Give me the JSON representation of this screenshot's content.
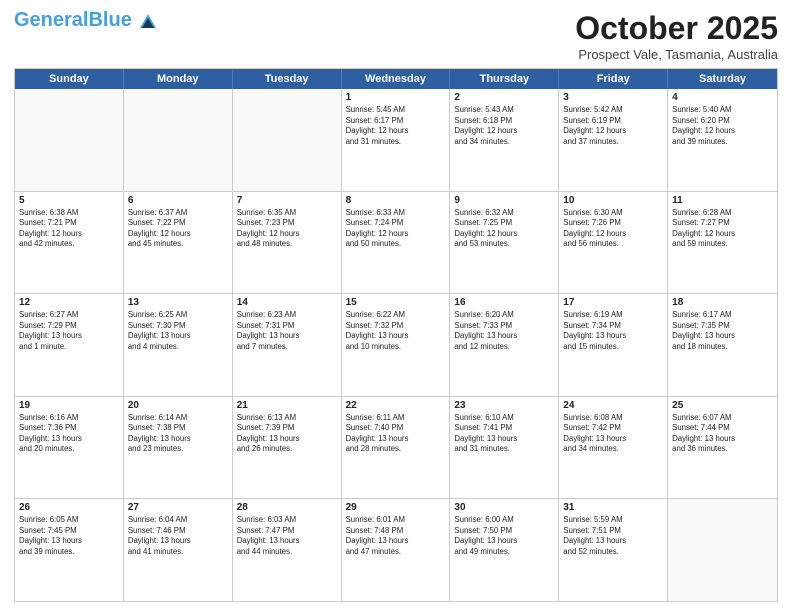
{
  "header": {
    "logo_general": "General",
    "logo_blue": "Blue",
    "month_title": "October 2025",
    "subtitle": "Prospect Vale, Tasmania, Australia"
  },
  "day_headers": [
    "Sunday",
    "Monday",
    "Tuesday",
    "Wednesday",
    "Thursday",
    "Friday",
    "Saturday"
  ],
  "weeks": [
    [
      {
        "num": "",
        "info": ""
      },
      {
        "num": "",
        "info": ""
      },
      {
        "num": "",
        "info": ""
      },
      {
        "num": "1",
        "info": "Sunrise: 5:45 AM\nSunset: 6:17 PM\nDaylight: 12 hours\nand 31 minutes."
      },
      {
        "num": "2",
        "info": "Sunrise: 5:43 AM\nSunset: 6:18 PM\nDaylight: 12 hours\nand 34 minutes."
      },
      {
        "num": "3",
        "info": "Sunrise: 5:42 AM\nSunset: 6:19 PM\nDaylight: 12 hours\nand 37 minutes."
      },
      {
        "num": "4",
        "info": "Sunrise: 5:40 AM\nSunset: 6:20 PM\nDaylight: 12 hours\nand 39 minutes."
      }
    ],
    [
      {
        "num": "5",
        "info": "Sunrise: 6:38 AM\nSunset: 7:21 PM\nDaylight: 12 hours\nand 42 minutes."
      },
      {
        "num": "6",
        "info": "Sunrise: 6:37 AM\nSunset: 7:22 PM\nDaylight: 12 hours\nand 45 minutes."
      },
      {
        "num": "7",
        "info": "Sunrise: 6:35 AM\nSunset: 7:23 PM\nDaylight: 12 hours\nand 48 minutes."
      },
      {
        "num": "8",
        "info": "Sunrise: 6:33 AM\nSunset: 7:24 PM\nDaylight: 12 hours\nand 50 minutes."
      },
      {
        "num": "9",
        "info": "Sunrise: 6:32 AM\nSunset: 7:25 PM\nDaylight: 12 hours\nand 53 minutes."
      },
      {
        "num": "10",
        "info": "Sunrise: 6:30 AM\nSunset: 7:26 PM\nDaylight: 12 hours\nand 56 minutes."
      },
      {
        "num": "11",
        "info": "Sunrise: 6:28 AM\nSunset: 7:27 PM\nDaylight: 12 hours\nand 59 minutes."
      }
    ],
    [
      {
        "num": "12",
        "info": "Sunrise: 6:27 AM\nSunset: 7:29 PM\nDaylight: 13 hours\nand 1 minute."
      },
      {
        "num": "13",
        "info": "Sunrise: 6:25 AM\nSunset: 7:30 PM\nDaylight: 13 hours\nand 4 minutes."
      },
      {
        "num": "14",
        "info": "Sunrise: 6:23 AM\nSunset: 7:31 PM\nDaylight: 13 hours\nand 7 minutes."
      },
      {
        "num": "15",
        "info": "Sunrise: 6:22 AM\nSunset: 7:32 PM\nDaylight: 13 hours\nand 10 minutes."
      },
      {
        "num": "16",
        "info": "Sunrise: 6:20 AM\nSunset: 7:33 PM\nDaylight: 13 hours\nand 12 minutes."
      },
      {
        "num": "17",
        "info": "Sunrise: 6:19 AM\nSunset: 7:34 PM\nDaylight: 13 hours\nand 15 minutes."
      },
      {
        "num": "18",
        "info": "Sunrise: 6:17 AM\nSunset: 7:35 PM\nDaylight: 13 hours\nand 18 minutes."
      }
    ],
    [
      {
        "num": "19",
        "info": "Sunrise: 6:16 AM\nSunset: 7:36 PM\nDaylight: 13 hours\nand 20 minutes."
      },
      {
        "num": "20",
        "info": "Sunrise: 6:14 AM\nSunset: 7:38 PM\nDaylight: 13 hours\nand 23 minutes."
      },
      {
        "num": "21",
        "info": "Sunrise: 6:13 AM\nSunset: 7:39 PM\nDaylight: 13 hours\nand 26 minutes."
      },
      {
        "num": "22",
        "info": "Sunrise: 6:11 AM\nSunset: 7:40 PM\nDaylight: 13 hours\nand 28 minutes."
      },
      {
        "num": "23",
        "info": "Sunrise: 6:10 AM\nSunset: 7:41 PM\nDaylight: 13 hours\nand 31 minutes."
      },
      {
        "num": "24",
        "info": "Sunrise: 6:08 AM\nSunset: 7:42 PM\nDaylight: 13 hours\nand 34 minutes."
      },
      {
        "num": "25",
        "info": "Sunrise: 6:07 AM\nSunset: 7:44 PM\nDaylight: 13 hours\nand 36 minutes."
      }
    ],
    [
      {
        "num": "26",
        "info": "Sunrise: 6:05 AM\nSunset: 7:45 PM\nDaylight: 13 hours\nand 39 minutes."
      },
      {
        "num": "27",
        "info": "Sunrise: 6:04 AM\nSunset: 7:46 PM\nDaylight: 13 hours\nand 41 minutes."
      },
      {
        "num": "28",
        "info": "Sunrise: 6:03 AM\nSunset: 7:47 PM\nDaylight: 13 hours\nand 44 minutes."
      },
      {
        "num": "29",
        "info": "Sunrise: 6:01 AM\nSunset: 7:48 PM\nDaylight: 13 hours\nand 47 minutes."
      },
      {
        "num": "30",
        "info": "Sunrise: 6:00 AM\nSunset: 7:50 PM\nDaylight: 13 hours\nand 49 minutes."
      },
      {
        "num": "31",
        "info": "Sunrise: 5:59 AM\nSunset: 7:51 PM\nDaylight: 13 hours\nand 52 minutes."
      },
      {
        "num": "",
        "info": ""
      }
    ]
  ]
}
